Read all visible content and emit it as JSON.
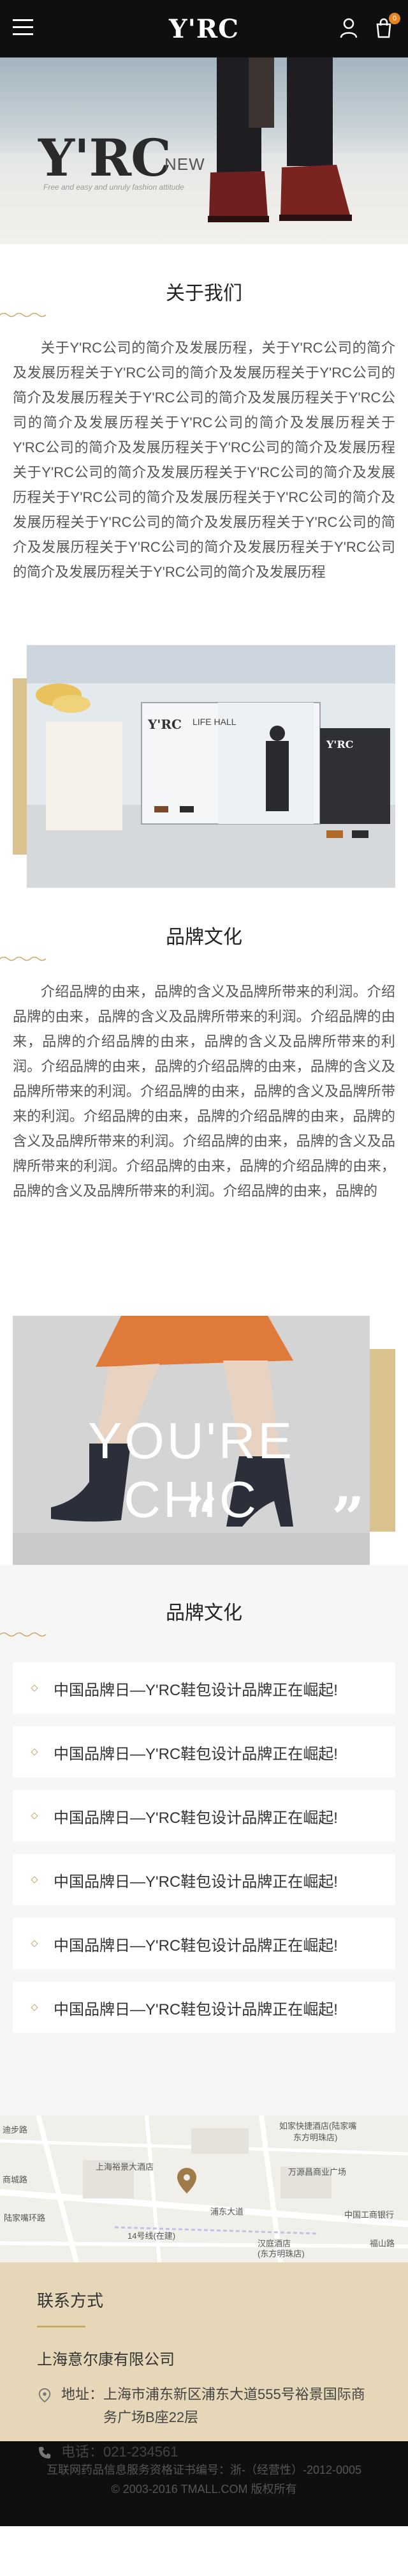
{
  "header": {
    "logo": "Y'RC",
    "cart_count": "0",
    "icons": [
      "menu-icon",
      "user-icon",
      "cart-icon"
    ]
  },
  "hero": {
    "brand": "Y'RC",
    "new_label": "NEW",
    "tagline": "Free and easy and unruly fashion attitude"
  },
  "about": {
    "title": "关于我们",
    "text": "关于Y'RC公司的简介及发展历程，关于Y'RC公司的简介及发展历程关于Y'RC公司的简介及发展历程关于Y'RC公司的简介及发展历程关于Y'RC公司的简介及发展历程关于Y'RC公司的简介及发展历程关于Y'RC公司的简介及发展历程关于Y'RC公司的简介及发展历程关于Y'RC公司的简介及发展历程关于Y'RC公司的简介及发展历程关于Y'RC公司的简介及发展历程关于Y'RC公司的简介及发展历程关于Y'RC公司的简介及发展历程关于Y'RC公司的简介及发展历程关于Y'RC公司的简介及发展历程关于Y'RC公司的简介及发展历程关于Y'RC公司的简介及发展历程关于Y'RC公司的简介及发展历程"
  },
  "store": {
    "brand_sign": "Y'RC",
    "hall_sign": "LIFE HALL"
  },
  "culture": {
    "title": "品牌文化",
    "text": "介绍品牌的由来，品牌的含义及品牌所带来的利润。介绍品牌的由来，品牌的含义及品牌所带来的利润。介绍品牌的由来，品牌的介绍品牌的由来，品牌的含义及品牌所带来的利润。介绍品牌的由来，品牌的介绍品牌的由来，品牌的含义及品牌所带来的利润。介绍品牌的由来，品牌的含义及品牌所带来的利润。介绍品牌的由来，品牌的介绍品牌的由来，品牌的含义及品牌所带来的利润。介绍品牌的由来，品牌的含义及品牌所带来的利润。介绍品牌的由来，品牌的介绍品牌的由来，品牌的含义及品牌所带来的利润。介绍品牌的由来，品牌的"
  },
  "chic": {
    "headline": "YOU'RE CHIC",
    "quote_open": "“",
    "quote_close": "”"
  },
  "news": {
    "title": "品牌文化",
    "items": [
      "中国品牌日—Y'RC鞋包设计品牌正在崛起!",
      "中国品牌日—Y'RC鞋包设计品牌正在崛起!",
      "中国品牌日—Y'RC鞋包设计品牌正在崛起!",
      "中国品牌日—Y'RC鞋包设计品牌正在崛起!",
      "中国品牌日—Y'RC鞋包设计品牌正在崛起!",
      "中国品牌日—Y'RC鞋包设计品牌正在崛起!"
    ]
  },
  "map": {
    "labels": [
      "迪步路",
      "如家快捷酒店(陆家嘴",
      "东方明珠店)",
      "上海裕景大酒店",
      "万源昌商业广场",
      "浦东大道",
      "汉庭酒店",
      "(东方明珠店)",
      "商城路",
      "14号线(在建)",
      "陆家嘴环路",
      "福山路",
      "中国工商银行"
    ]
  },
  "contact": {
    "title": "联系方式",
    "company": "上海意尔康有限公司",
    "address_label": "地址：",
    "address": "上海市浦东新区浦东大道555号裕景国际商务广场B座22层",
    "phone_label": "电话：",
    "phone": "021-234561"
  },
  "footer": {
    "line1": "互联网药品信息服务资格证书编号：浙-（经营性）-2012-0005",
    "line2": "© 2003-2016 TMALL.COM 版权所有"
  }
}
